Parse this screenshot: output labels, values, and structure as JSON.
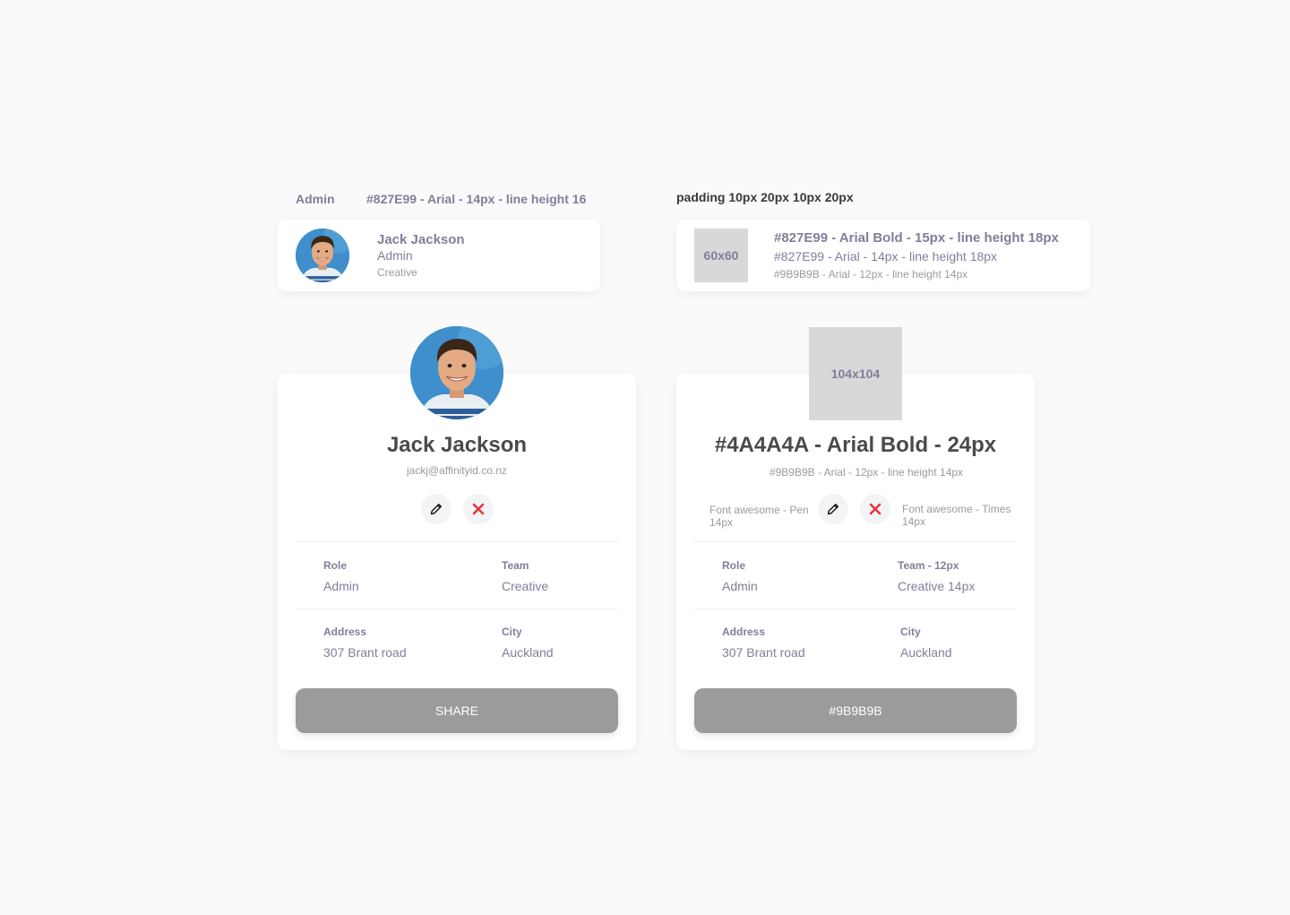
{
  "annotations": {
    "role_label": "Admin",
    "small_text_spec": "#827E99 - Arial - 14px - line height 16",
    "padding_spec": "padding 10px 20px 10px 20px"
  },
  "small_card": {
    "name": "Jack Jackson",
    "role": "Admin",
    "team": "Creative"
  },
  "small_spec_card": {
    "placeholder": "60x60",
    "name_spec": "#827E99 - Arial Bold - 15px - line height 18px",
    "role_spec": "#827E99 - Arial - 14px - line height 18px",
    "team_spec": "#9B9B9B - Arial - 12px - line height 14px"
  },
  "profile_card": {
    "name": "Jack Jackson",
    "email": "jackj@affinityid.co.nz",
    "fields": [
      {
        "label": "Role",
        "value": "Admin"
      },
      {
        "label": "Team",
        "value": "Creative"
      },
      {
        "label": "Address",
        "value": "307 Brant road"
      },
      {
        "label": "City",
        "value": "Auckland"
      }
    ],
    "button_label": "SHARE"
  },
  "spec_card": {
    "placeholder": "104x104",
    "title_spec": "#4A4A4A - Arial Bold - 24px",
    "sub_spec": "#9B9B9B - Arial - 12px - line height 14px",
    "pen_note_line1": "Font awesome - Pen",
    "pen_note_line2": "14px",
    "times_note_line1": "Font awesome - Times",
    "times_note_line2": "14px",
    "fields": [
      {
        "label": "Role",
        "value": "Admin"
      },
      {
        "label": "Team - 12px",
        "value": "Creative 14px"
      },
      {
        "label": "Address",
        "value": "307 Brant road"
      },
      {
        "label": "City",
        "value": "Auckland"
      }
    ],
    "button_label": "#9B9B9B"
  },
  "colors": {
    "background": "#FAFAFA",
    "accent_text": "#827E99",
    "title_text": "#4A4A4A",
    "muted_text": "#9B9B9B",
    "button": "#9B9B9B",
    "times_icon": "#E8363C",
    "placeholder": "#D8D8D8"
  },
  "icons": {
    "edit": "pencil-icon",
    "delete": "times-icon"
  }
}
